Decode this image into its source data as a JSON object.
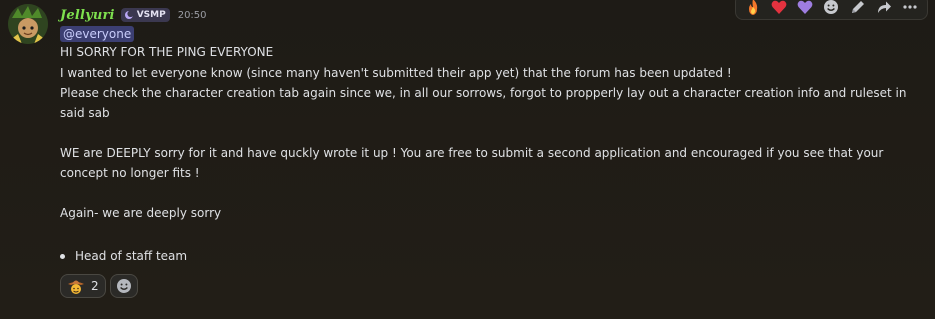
{
  "message": {
    "username": "Jellyuri",
    "server_tag": "VSMP",
    "timestamp": "20:50",
    "mention": "@everyone",
    "lines": [
      "HI SORRY FOR THE PING EVERYONE",
      "I wanted to let everyone know (since many haven't submitted their app yet) that the forum has been updated !",
      "Please check the character creation tab again since we, in all our sorrows, forgot to propperly lay out a character creation info and ruleset in",
      "said sab",
      "WE are DEEPLY sorry for it and have quckly wrote it up ! You are free to submit a second application and encouraged if you see that your",
      "concept no longer fits !",
      "Again- we are deeply sorry"
    ],
    "bullet": "Head of staff team"
  },
  "reactions": [
    {
      "emoji": "cowboy-face-emoji",
      "count": "2"
    },
    {
      "emoji": "add-reaction-icon"
    }
  ],
  "toolbar": [
    "fire-emoji",
    "heart-emoji",
    "purple-heart-emoji",
    "add-reaction-icon",
    "edit-icon",
    "forward-icon",
    "more-icon"
  ],
  "colors": {
    "username": "#7ee04e",
    "mention_bg": "#3c3f72",
    "mention_text": "#c9cdfb",
    "background": "#1e1b16"
  }
}
